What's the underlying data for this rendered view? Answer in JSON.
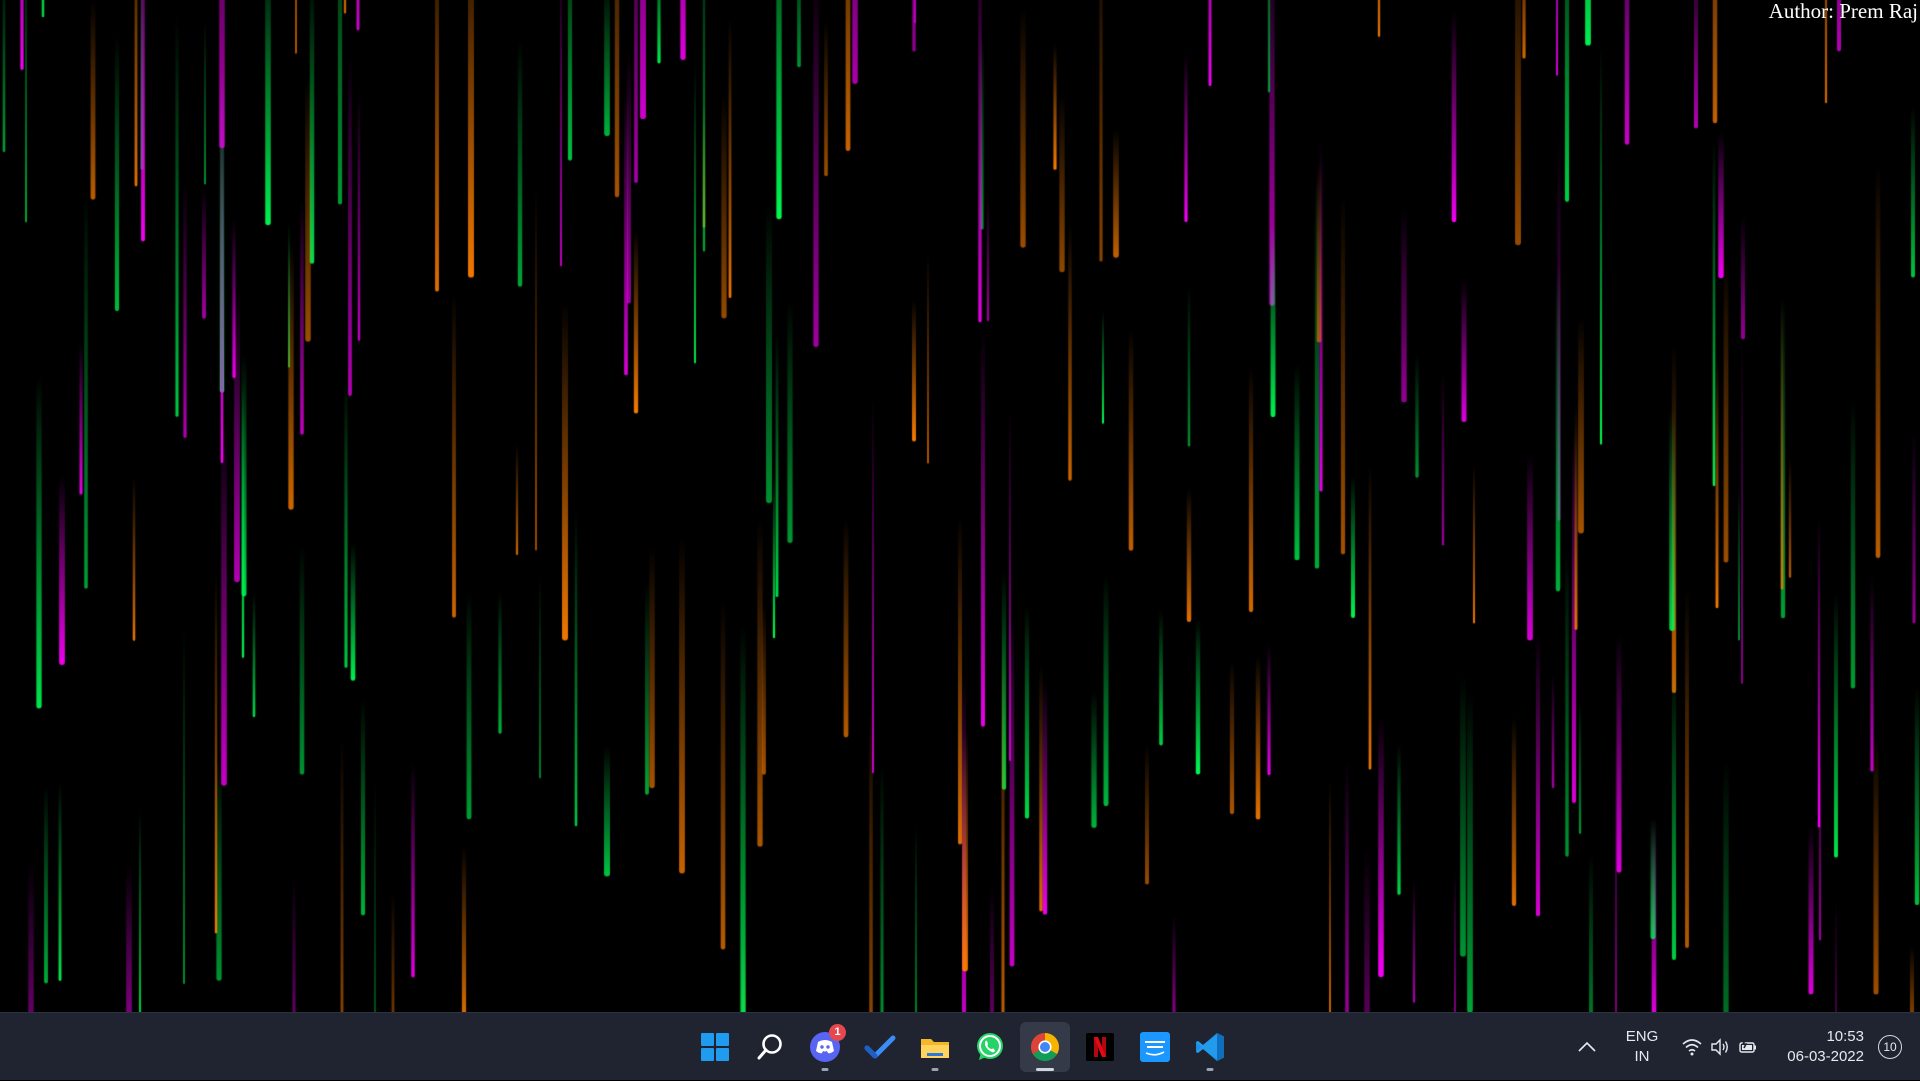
{
  "wallpaper": {
    "author_label": "Author: Prem Raj",
    "background": "#000000",
    "streak_colors": [
      "#ff00ff",
      "#ff7f00",
      "#00ff55"
    ]
  },
  "taskbar": {
    "background": "#1f2430",
    "apps": [
      {
        "name": "start-button",
        "icon": "windows-icon",
        "title": "Start",
        "active": false,
        "running": false
      },
      {
        "name": "search-button",
        "icon": "search-icon",
        "title": "Search",
        "active": false,
        "running": false
      },
      {
        "name": "discord-button",
        "icon": "discord-icon",
        "title": "Discord",
        "active": false,
        "running": true,
        "badge": "1"
      },
      {
        "name": "todo-button",
        "icon": "checkmark-icon",
        "title": "Microsoft To Do",
        "active": false,
        "running": false
      },
      {
        "name": "file-explorer-button",
        "icon": "folder-icon",
        "title": "File Explorer",
        "active": false,
        "running": true
      },
      {
        "name": "whatsapp-button",
        "icon": "whatsapp-icon",
        "title": "WhatsApp",
        "active": false,
        "running": false
      },
      {
        "name": "chrome-button",
        "icon": "chrome-icon",
        "title": "Google Chrome",
        "active": true,
        "running": true
      },
      {
        "name": "netflix-button",
        "icon": "netflix-icon",
        "title": "Netflix",
        "active": false,
        "running": false
      },
      {
        "name": "prime-video-button",
        "icon": "prime-video-icon",
        "title": "Prime Video",
        "active": false,
        "running": false
      },
      {
        "name": "vscode-button",
        "icon": "vscode-icon",
        "title": "Visual Studio Code",
        "active": false,
        "running": true
      }
    ],
    "tray": {
      "overflow_icon": "chevron-up-icon",
      "language_line1": "ENG",
      "language_line2": "IN",
      "status_icons": [
        "wifi-icon",
        "speaker-icon",
        "battery-charging-icon"
      ],
      "time": "10:53",
      "date": "06-03-2022",
      "notification_count": "10"
    }
  }
}
